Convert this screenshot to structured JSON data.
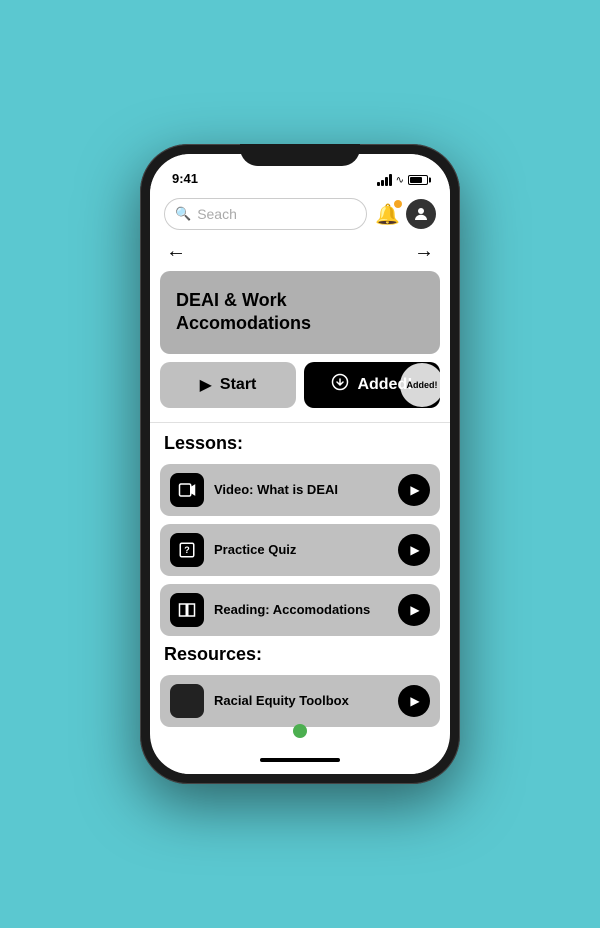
{
  "status": {
    "time": "9:41"
  },
  "topbar": {
    "search_placeholder": "Seach",
    "back_arrow": "←",
    "forward_arrow": "→"
  },
  "course": {
    "title": "DEAI & Work Accomodations",
    "start_label": "Start",
    "added_label": "Added!"
  },
  "lessons": {
    "section_label": "Lessons:",
    "items": [
      {
        "label": "Video: What is DEAI",
        "icon_type": "video"
      },
      {
        "label": "Practice Quiz",
        "icon_type": "quiz"
      },
      {
        "label": "Reading: Accomodations",
        "icon_type": "book"
      }
    ]
  },
  "resources": {
    "section_label": "Resources:",
    "items": [
      {
        "label": "Racial Equity Toolbox",
        "icon_type": "resource"
      }
    ]
  }
}
